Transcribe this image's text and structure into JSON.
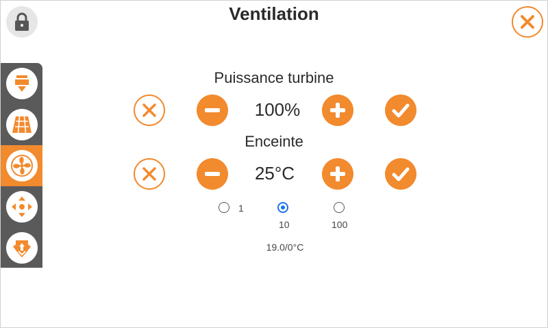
{
  "header": {
    "title": "Ventilation"
  },
  "icons": {
    "lock": "lock-icon",
    "close": "close-icon"
  },
  "sidebar": {
    "items": [
      {
        "name": "extruder",
        "icon": "extruder-icon"
      },
      {
        "name": "bed",
        "icon": "heated-bed-icon"
      },
      {
        "name": "fan",
        "icon": "fan-icon",
        "active": true
      },
      {
        "name": "move",
        "icon": "move-axes-icon"
      },
      {
        "name": "filament",
        "icon": "filament-load-icon"
      }
    ]
  },
  "controls": [
    {
      "label": "Puissance turbine",
      "value": "100%"
    },
    {
      "label": "Enceinte",
      "value": "25°C"
    }
  ],
  "step": {
    "options": [
      "1",
      "10",
      "100"
    ],
    "selected": "10"
  },
  "status": "19.0/0°C",
  "colors": {
    "accent": "#f28a2e",
    "sidebar": "#5a5a5a",
    "radio_selected": "#1a73e8"
  }
}
